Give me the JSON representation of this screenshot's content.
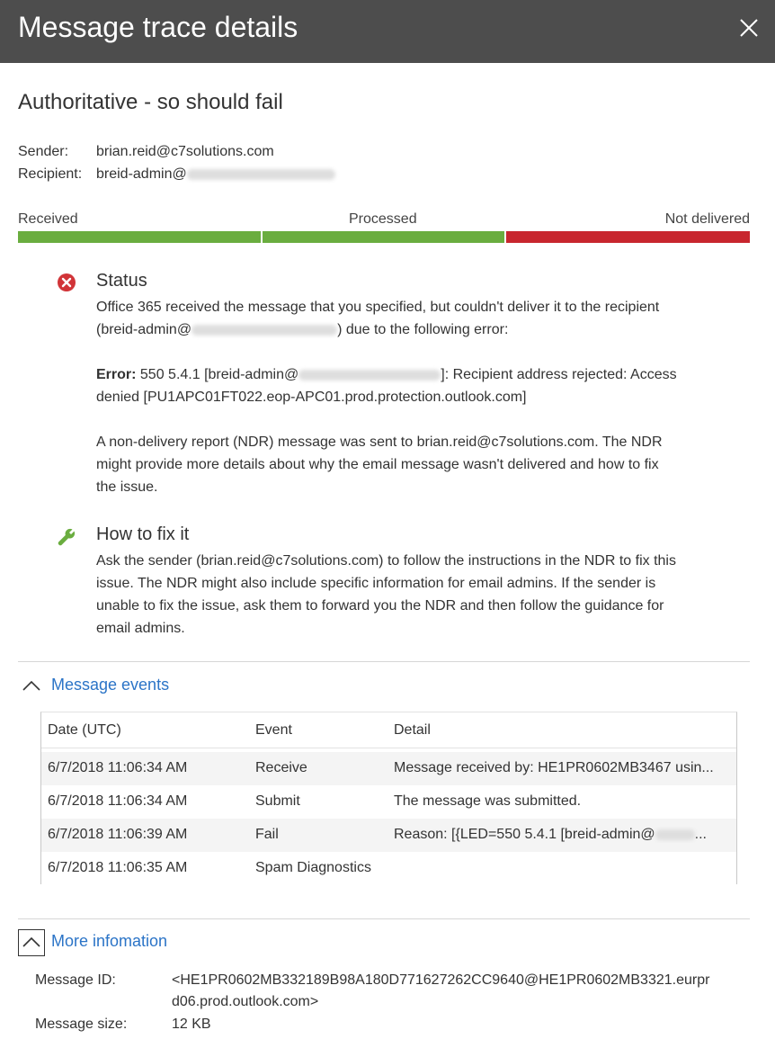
{
  "panel": {
    "title": "Message trace details",
    "close_icon": "close-icon"
  },
  "subject": "Authoritative - so should fail",
  "sender": {
    "label": "Sender:",
    "value": "brian.reid@c7solutions.com"
  },
  "recipient": {
    "label": "Recipient:",
    "value": "breid-admin@"
  },
  "progress": {
    "stages": [
      {
        "label": "Received",
        "color": "#6aad3f",
        "state": "complete"
      },
      {
        "label": "Processed",
        "color": "#6aad3f",
        "state": "complete"
      },
      {
        "label": "Not delivered",
        "color": "#c8262e",
        "state": "failed"
      }
    ]
  },
  "status": {
    "icon": "error-x-icon",
    "heading": "Status",
    "line1": "Office 365 received the message that you specified, but couldn't deliver it to the recipient",
    "line2_pre": "(breid-admin@",
    "line2_post": ") due to the following error:",
    "error_label": "Error:",
    "error_pre": "550 5.4.1 [breid-admin@",
    "error_post": "]: Recipient address rejected: Access",
    "error_line2": "denied [PU1APC01FT022.eop-APC01.prod.protection.outlook.com]",
    "ndr_line1": "A non-delivery report (NDR) message was sent to brian.reid@c7solutions.com. The NDR",
    "ndr_line2": "might provide more details about why the email message wasn't delivered and how to fix",
    "ndr_line3": "the issue."
  },
  "fix": {
    "icon": "wrench-icon",
    "heading": "How to fix it",
    "line1": "Ask the sender (brian.reid@c7solutions.com) to follow the instructions in the NDR to fix this",
    "line2": "issue. The NDR might also include specific information for email admins. If the sender is",
    "line3": "unable to fix the issue, ask them to forward you the NDR and then follow the guidance for",
    "line4": "email admins."
  },
  "events": {
    "toggle_label": "Message events",
    "columns": {
      "date": "Date (UTC)",
      "event": "Event",
      "detail": "Detail"
    },
    "rows": [
      {
        "date": "6/7/2018 11:06:34 AM",
        "event": "Receive",
        "detail": "Message received by: HE1PR0602MB3467 usin..."
      },
      {
        "date": "6/7/2018 11:06:34 AM",
        "event": "Submit",
        "detail": "The message was submitted."
      },
      {
        "date": "6/7/2018 11:06:39 AM",
        "event": "Fail",
        "detail_pre": "Reason: [{LED=550 5.4.1 [breid-admin@",
        "detail_post": "..."
      },
      {
        "date": "6/7/2018 11:06:35 AM",
        "event": "Spam Diagnostics",
        "detail": ""
      }
    ]
  },
  "more_info": {
    "toggle_label": "More infomation",
    "message_id_label": "Message ID:",
    "message_id_line1": "<HE1PR0602MB332189B98A180D771627262CC9640@HE1PR0602MB3321.eurpr",
    "message_id_line2": "d06.prod.outlook.com>",
    "size_label": "Message size:",
    "size_value": "12 KB"
  }
}
